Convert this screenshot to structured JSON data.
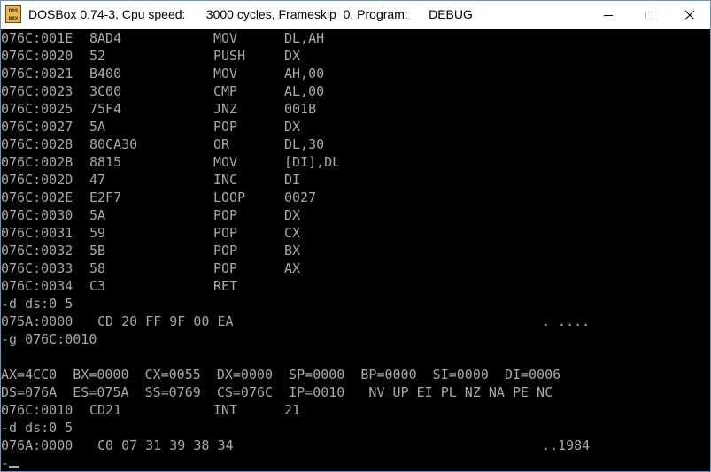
{
  "window": {
    "title_app": "DOSBox 0.74-3, Cpu speed:",
    "title_cycles": "3000 cycles, Frameskip  0, Program:",
    "title_program": "DEBUG",
    "icon_label_top": "DOS",
    "icon_label_bottom": "BOX"
  },
  "terminal": {
    "disasm_top": [
      {
        "addr": "076C:001E",
        "bytes": "8AD4",
        "op": "MOV",
        "args": "DL,AH"
      },
      {
        "addr": "076C:0020",
        "bytes": "52",
        "op": "PUSH",
        "args": "DX"
      },
      {
        "addr": "076C:0021",
        "bytes": "B400",
        "op": "MOV",
        "args": "AH,00"
      },
      {
        "addr": "076C:0023",
        "bytes": "3C00",
        "op": "CMP",
        "args": "AL,00"
      },
      {
        "addr": "076C:0025",
        "bytes": "75F4",
        "op": "JNZ",
        "args": "001B"
      },
      {
        "addr": "076C:0027",
        "bytes": "5A",
        "op": "POP",
        "args": "DX"
      },
      {
        "addr": "076C:0028",
        "bytes": "80CA30",
        "op": "OR",
        "args": "DL,30"
      },
      {
        "addr": "076C:002B",
        "bytes": "8815",
        "op": "MOV",
        "args": "[DI],DL"
      },
      {
        "addr": "076C:002D",
        "bytes": "47",
        "op": "INC",
        "args": "DI"
      },
      {
        "addr": "076C:002E",
        "bytes": "E2F7",
        "op": "LOOP",
        "args": "0027"
      },
      {
        "addr": "076C:0030",
        "bytes": "5A",
        "op": "POP",
        "args": "DX"
      },
      {
        "addr": "076C:0031",
        "bytes": "59",
        "op": "POP",
        "args": "CX"
      },
      {
        "addr": "076C:0032",
        "bytes": "5B",
        "op": "POP",
        "args": "BX"
      },
      {
        "addr": "076C:0033",
        "bytes": "58",
        "op": "POP",
        "args": "AX"
      },
      {
        "addr": "076C:0034",
        "bytes": "C3",
        "op": "RET",
        "args": ""
      }
    ],
    "cmd_dump_1": "-d ds:0 5",
    "dump_1": {
      "addr": "075A:0000",
      "bytes": "CD 20 FF 9F 00 EA",
      "ascii": ". ...."
    },
    "cmd_go": "-g 076C:0010",
    "blank": "",
    "registers": "AX=4CC0  BX=0000  CX=0055  DX=0000  SP=0000  BP=0000  SI=0000  DI=0006",
    "segments_flags": "DS=076A  ES=075A  SS=0769  CS=076C  IP=0010   NV UP EI PL NZ NA PE NC",
    "disasm_current": {
      "addr": "076C:0010",
      "bytes": "CD21",
      "op": "INT",
      "args": "21"
    },
    "cmd_dump_2": "-d ds:0 5",
    "dump_2": {
      "addr": "076A:0000",
      "bytes": "C0 07 31 39 38 34",
      "ascii": "..1984"
    },
    "prompt": "-"
  }
}
